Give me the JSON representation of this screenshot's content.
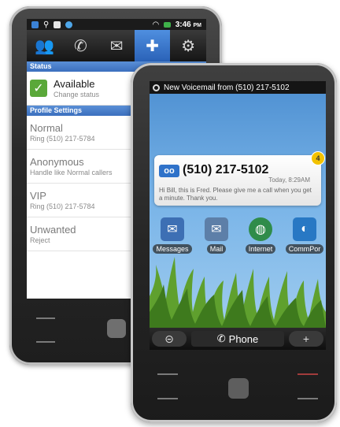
{
  "back_phone": {
    "status_bar": {
      "time": "3:46",
      "ampm": "PM"
    },
    "tabs": [
      {
        "name": "contacts",
        "glyph": "👥"
      },
      {
        "name": "call",
        "glyph": "✆"
      },
      {
        "name": "messages",
        "glyph": "✉"
      },
      {
        "name": "add",
        "glyph": "✚"
      },
      {
        "name": "settings",
        "glyph": "⚙"
      }
    ],
    "status_section": "Status",
    "status": {
      "title": "Available",
      "subtitle": "Change status"
    },
    "profile_section": "Profile Settings",
    "profiles": [
      {
        "title": "Normal",
        "subtitle": "Ring (510) 217-5784"
      },
      {
        "title": "Anonymous",
        "subtitle": "Handle like Normal callers"
      },
      {
        "title": "VIP",
        "subtitle": "Ring (510) 217-5784"
      },
      {
        "title": "Unwanted",
        "subtitle": "Reject"
      }
    ]
  },
  "front_phone": {
    "notification": "New Voicemail from (510) 217-5102",
    "voicemail": {
      "icon_text": "oo",
      "number": "(510) 217-5102",
      "time": "Today, 8:29AM",
      "badge": "4",
      "body": "Hi Bill, this is Fred. Please give me a call when you get a minute. Thank you."
    },
    "apps": [
      {
        "label": "Messages",
        "glyph": "✉",
        "color": "#3d6fb4"
      },
      {
        "label": "Mail",
        "glyph": "✉",
        "color": "#5d7fa8"
      },
      {
        "label": "Internet",
        "glyph": "◍",
        "color": "#2f8c4a"
      },
      {
        "label": "CommPor",
        "glyph": "◐",
        "color": "#2878c4"
      }
    ],
    "dock": {
      "left": "⊝",
      "phone": "Phone",
      "phone_glyph": "✆",
      "right": "+"
    }
  }
}
